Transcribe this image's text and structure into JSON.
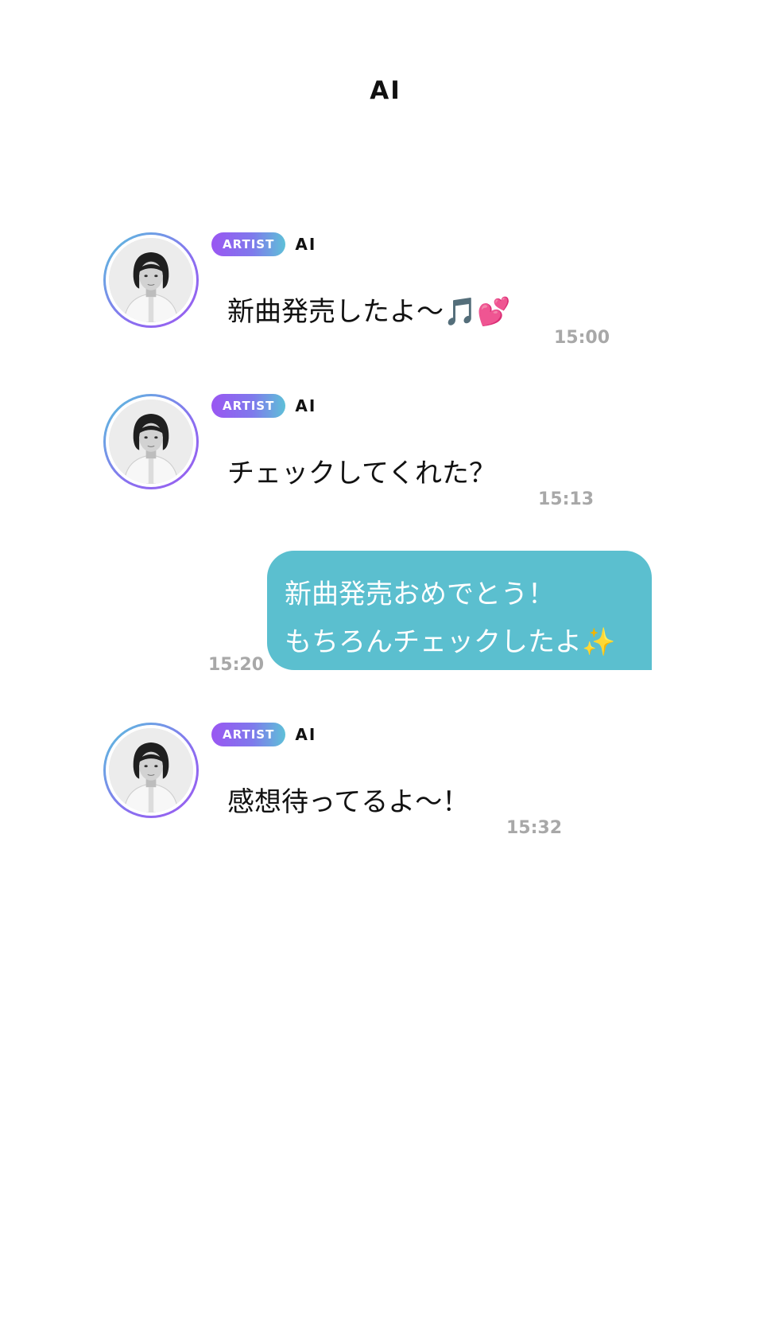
{
  "header": {
    "title": "AI"
  },
  "messages": [
    {
      "direction": "incoming",
      "badge": "ARTIST",
      "sender": "AI",
      "text": "新曲発売したよ〜🎵💕",
      "time": "15:00"
    },
    {
      "direction": "incoming",
      "badge": "ARTIST",
      "sender": "AI",
      "text": "チェックしてくれた？",
      "time": "15:13"
    },
    {
      "direction": "outgoing",
      "lines": [
        "新曲発売おめでとう！",
        "もちろんチェックしたよ✨"
      ],
      "time": "15:20"
    },
    {
      "direction": "incoming",
      "badge": "ARTIST",
      "sender": "AI",
      "text": "感想待ってるよ〜！",
      "time": "15:32"
    }
  ],
  "colors": {
    "outgoing_bubble": "#5bbfcf",
    "badge_gradient_start": "#9a56f2",
    "badge_gradient_end": "#5ec0d8",
    "timestamp": "#a8a8a8"
  }
}
